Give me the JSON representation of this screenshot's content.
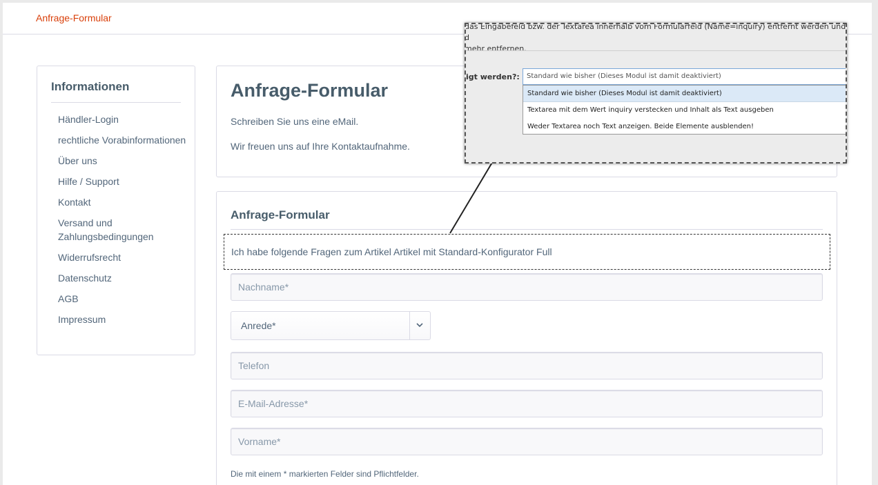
{
  "breadcrumb": {
    "current": "Anfrage-Formular"
  },
  "sidebar": {
    "title": "Informationen",
    "items": [
      {
        "label": "Händler-Login"
      },
      {
        "label": "rechtliche Vorabinformationen"
      },
      {
        "label": "Über uns"
      },
      {
        "label": "Hilfe / Support"
      },
      {
        "label": "Kontakt"
      },
      {
        "label": "Versand und Zahlungsbedingungen"
      },
      {
        "label": "Widerrufsrecht"
      },
      {
        "label": "Datenschutz"
      },
      {
        "label": "AGB"
      },
      {
        "label": "Impressum"
      }
    ]
  },
  "main": {
    "title": "Anfrage-Formular",
    "intro_1": "Schreiben Sie uns eine eMail.",
    "intro_2": "Wir freuen uns auf Ihre Kontaktaufnahme."
  },
  "form": {
    "title": "Anfrage-Formular",
    "inquiry_text": "Ich habe folgende Fragen zum Artikel Artikel mit Standard-Konfigurator Full",
    "nachname_placeholder": "Nachname*",
    "anrede_value": "Anrede*",
    "telefon_placeholder": "Telefon",
    "email_placeholder": "E-Mail-Adresse*",
    "vorname_placeholder": "Vorname*",
    "required_note": "Die mit einem * markierten Felder sind Pflichtfelder."
  },
  "overlay": {
    "description_line1": "das Eingabefeld bzw. der Textarea innerhalb vom Formularfeld (Name=inquiry) entfernt werden und d",
    "description_line2": "mehr entfernen.",
    "field_label": "igt werden?:",
    "selected_value": "Standard wie bisher (Dieses Modul ist damit deaktiviert)",
    "options": [
      {
        "label": "Standard wie bisher (Dieses Modul ist damit deaktiviert)"
      },
      {
        "label": "Textarea mit dem Wert inquiry verstecken und Inhalt als Text ausgeben"
      },
      {
        "label": "Weder Textarea noch Text anzeigen. Beide Elemente ausblenden!"
      }
    ]
  },
  "colors": {
    "accent": "#d9400b",
    "text": "#52667a",
    "heading": "#475c6a",
    "border": "#dadae5"
  }
}
